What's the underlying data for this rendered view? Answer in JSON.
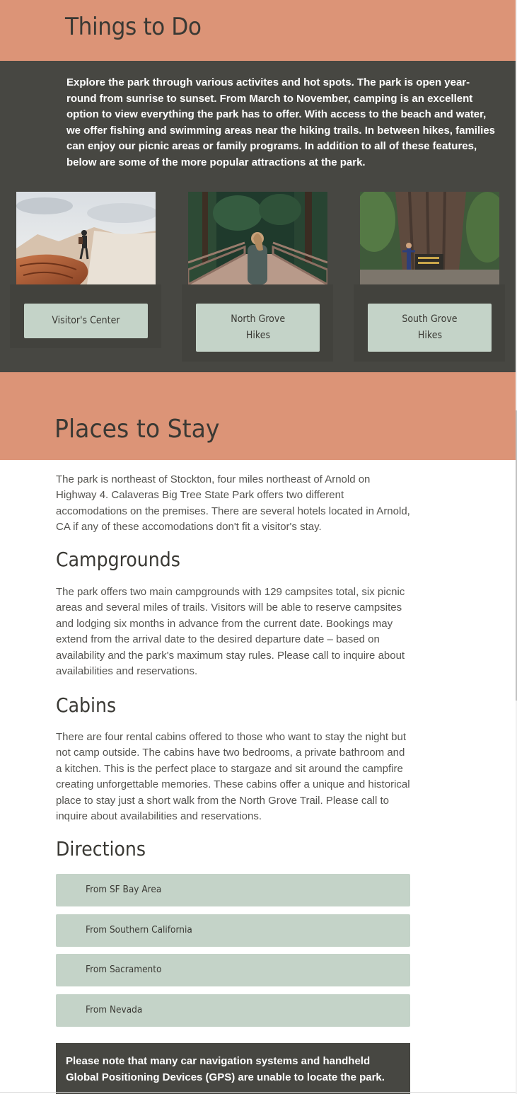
{
  "things_to_do": {
    "heading": "Things to Do",
    "intro": "Explore the park through various activites and hot spots. The park is open year-round from sunrise to sunset. From March to November, camping is an excellent option to view everything the park has to offer. With access to the beach and water, we offer fishing and swimming areas near the hiking trails. In between hikes, families can enjoy our picnic areas or family programs. In addition to all of these features, below are some of the more popular attractions at the park.",
    "cards": [
      {
        "image": "hiker-on-canyon-rocks-photo",
        "button_lines": [
          "Visitor's Center"
        ]
      },
      {
        "image": "woman-on-forest-bridge-photo",
        "button_lines": [
          "North Grove",
          "Hikes"
        ]
      },
      {
        "image": "person-at-giant-sequoia-photo",
        "button_lines": [
          "South Grove",
          "Hikes"
        ]
      }
    ]
  },
  "places_to_stay": {
    "heading": "Places to Stay",
    "intro": "The park is northeast of Stockton, four miles northeast of Arnold on Highway 4. Calaveras Big Tree State Park offers two different accomodations on the premises. There are several hotels located in Arnold, CA if any of these accomodations don't fit a visitor's stay.",
    "campgrounds": {
      "heading": "Campgrounds",
      "text": "The park offers two main campgrounds with 129 campsites total, six picnic areas and several miles of trails. Visitors will be able to reserve campsites and lodging six months in advance from the current date. Bookings may extend from the arrival date to the desired departure date – based on availability and the park's maximum stay rules. Please call to inquire about availabilities and reservations."
    },
    "cabins": {
      "heading": "Cabins",
      "text": "There are four rental cabins offered to those who want to stay the night but not camp outside. The cabins have two bedrooms, a private bathroom and a kitchen. This is the perfect place to stargaze and sit around the campfire creating unforgettable memories. These cabins offer a unique and historical place to stay just a short walk from the North Grove Trail. Please call to inquire about availabilities and reservations."
    }
  },
  "directions": {
    "heading": "Directions",
    "buttons": [
      "From SF Bay Area",
      "From Southern California",
      "From Sacramento",
      "From Nevada"
    ],
    "note": "Please note that many car navigation systems and handheld Global Positioning Devices (GPS) are unable to locate the park."
  },
  "colors": {
    "header_band": "#dc9477",
    "dark_band": "#474742",
    "button_bg": "#c4d3c8",
    "heading_text": "#3a3934",
    "body_text": "#54534f"
  }
}
